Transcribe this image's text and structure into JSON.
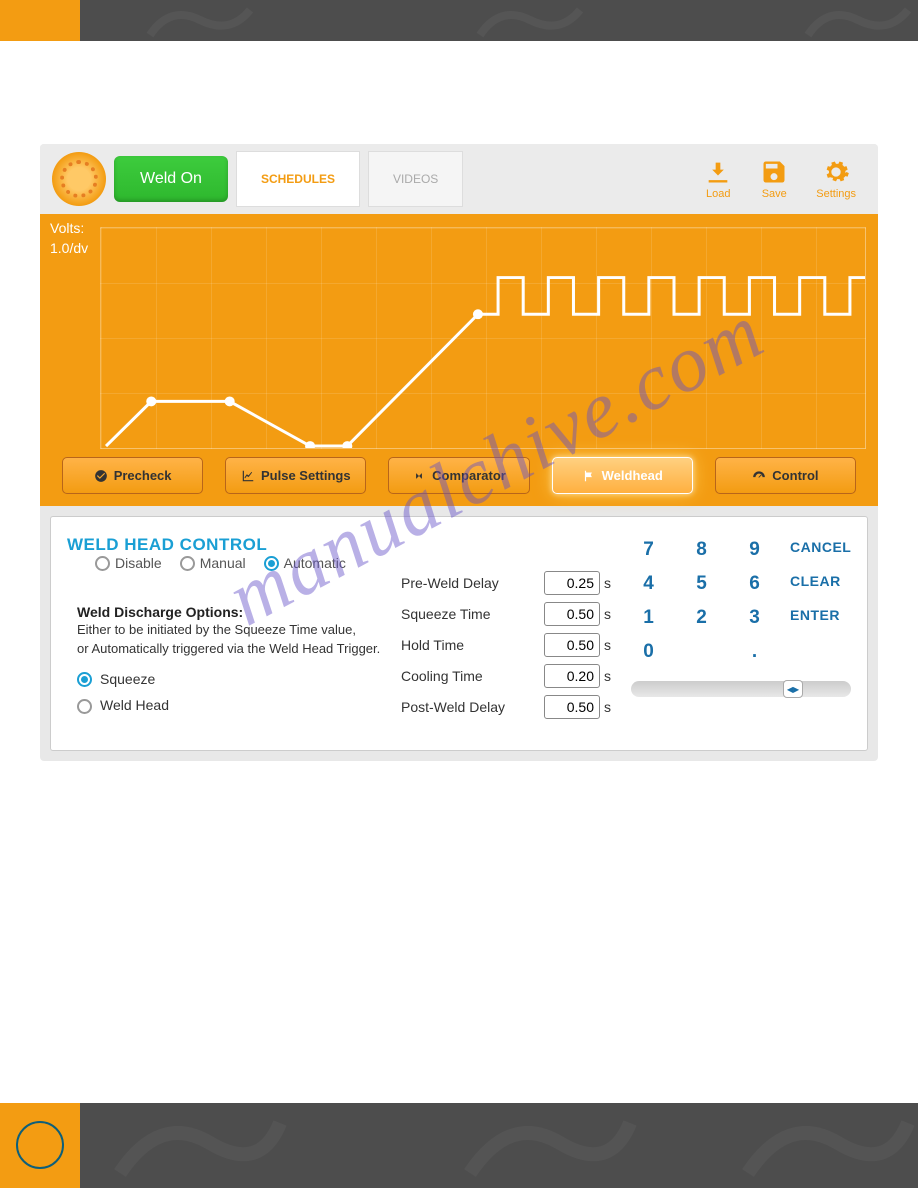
{
  "header": {
    "weld_on": "Weld On",
    "tabs": [
      "SCHEDULES",
      "VIDEOS"
    ],
    "actions": {
      "load": "Load",
      "save": "Save",
      "settings": "Settings"
    }
  },
  "chart": {
    "y_label_1": "Volts:",
    "y_label_2": "1.0/dv"
  },
  "subtabs": {
    "precheck": "Precheck",
    "pulse": "Pulse Settings",
    "comparator": "Comparator",
    "weldhead": "Weldhead",
    "control": "Control"
  },
  "panel": {
    "title": "WELD HEAD CONTROL",
    "modes": {
      "disable": "Disable",
      "manual": "Manual",
      "automatic": "Automatic"
    },
    "selected_mode": "automatic",
    "discharge": {
      "title": "Weld Discharge Options:",
      "desc1": "Either to be initiated by the Squeeze Time value,",
      "desc2": "or Automatically triggered via the Weld Head Trigger.",
      "options": {
        "squeeze": "Squeeze",
        "weld_head": "Weld Head"
      },
      "selected": "squeeze"
    },
    "timings": [
      {
        "label": "Pre-Weld Delay",
        "value": "0.25",
        "unit": "s"
      },
      {
        "label": "Squeeze Time",
        "value": "0.50",
        "unit": "s"
      },
      {
        "label": "Hold Time",
        "value": "0.50",
        "unit": "s"
      },
      {
        "label": "Cooling Time",
        "value": "0.20",
        "unit": "s"
      },
      {
        "label": "Post-Weld Delay",
        "value": "0.50",
        "unit": "s"
      }
    ],
    "keypad": {
      "keys": [
        [
          "7",
          "8",
          "9"
        ],
        [
          "4",
          "5",
          "6"
        ],
        [
          "1",
          "2",
          "3"
        ],
        [
          "0",
          "",
          ". "
        ]
      ],
      "actions": [
        "CANCEL",
        "CLEAR",
        "ENTER",
        ""
      ]
    }
  },
  "watermark": "manualchive.com",
  "chart_data": {
    "type": "line",
    "title": "",
    "xlabel": "",
    "ylabel": "Volts: 1.0/dv",
    "ylim": [
      0,
      1.0
    ],
    "x": [
      0,
      0.06,
      0.17,
      0.27,
      0.32,
      0.49,
      0.52,
      0.52,
      0.55,
      0.55,
      0.58,
      0.58,
      0.61,
      0.61,
      0.64,
      0.64,
      0.67,
      0.67,
      0.7,
      0.7,
      0.73,
      0.73,
      0.76,
      0.76,
      0.79,
      0.79,
      0.82,
      0.82,
      0.85,
      0.85,
      0.88,
      0.88,
      0.91,
      0.91,
      0.94,
      0.94,
      0.975,
      1.0
    ],
    "values": [
      0,
      0.21,
      0.21,
      0,
      0,
      0.61,
      0.61,
      0.78,
      0.78,
      0.61,
      0.61,
      0.78,
      0.78,
      0.61,
      0.61,
      0.78,
      0.78,
      0.61,
      0.61,
      0.78,
      0.78,
      0.61,
      0.61,
      0.78,
      0.78,
      0.61,
      0.61,
      0.78,
      0.78,
      0.61,
      0.61,
      0.78,
      0.78,
      0.61,
      0.61,
      0.78,
      0.61,
      0
    ]
  }
}
